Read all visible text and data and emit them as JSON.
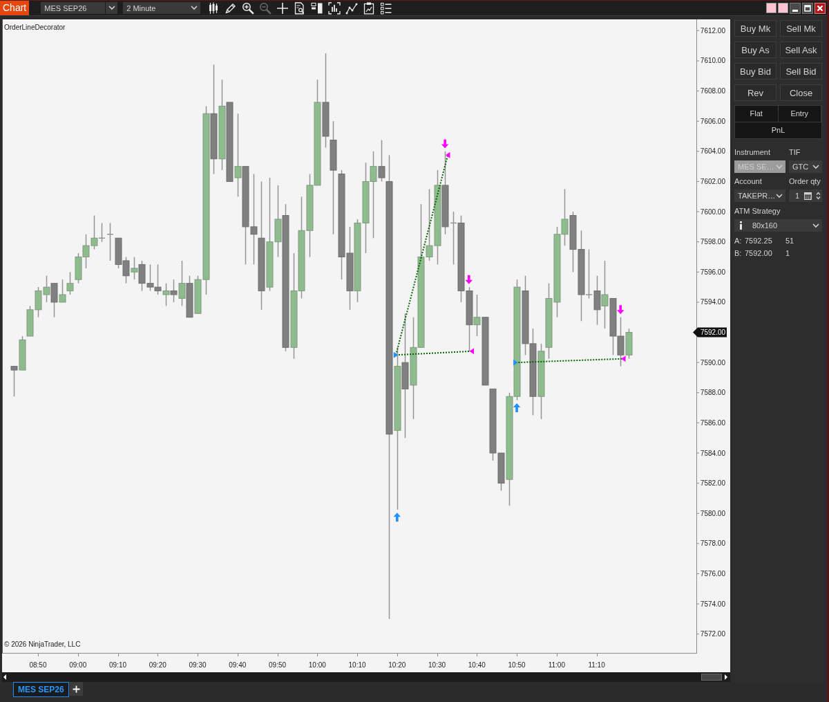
{
  "header": {
    "title": "Chart",
    "instrument": "MES SEP26",
    "interval": "2 Minute",
    "tools": [
      {
        "kind": "candles",
        "disabled": false
      },
      {
        "kind": "pencil",
        "disabled": false
      },
      {
        "kind": "zoom-in",
        "disabled": false
      },
      {
        "kind": "zoom-out",
        "disabled": true
      },
      {
        "kind": "crosshair",
        "disabled": false
      },
      {
        "kind": "data-box",
        "disabled": false
      },
      {
        "kind": "panel",
        "disabled": false
      },
      {
        "kind": "frame-chart",
        "disabled": false
      },
      {
        "kind": "line-chart",
        "disabled": false
      },
      {
        "kind": "clipboard",
        "disabled": false
      },
      {
        "kind": "list",
        "disabled": false
      }
    ]
  },
  "chart": {
    "indicator": "OrderLineDecorator",
    "copyright": "© 2026 NinjaTrader, LLC",
    "last_price": "7592.00",
    "chart_data": {
      "type": "candlestick",
      "x": [
        524,
        526,
        528,
        530,
        532,
        534,
        536,
        538,
        540,
        542,
        544,
        546,
        548,
        550,
        552,
        554,
        556,
        558,
        560,
        562,
        564,
        566,
        568,
        570,
        572,
        574,
        576,
        578,
        580,
        582,
        584,
        586,
        588,
        590,
        592,
        594,
        596,
        598,
        600,
        602,
        604,
        606,
        608,
        610,
        612,
        614,
        616,
        618,
        620,
        622,
        624,
        626,
        628,
        630,
        632,
        634,
        636,
        638,
        640,
        642,
        644,
        646,
        648,
        650,
        652,
        654,
        656,
        658,
        660,
        662,
        664,
        666,
        668,
        670,
        672,
        674,
        676,
        678
      ],
      "ohlc": [
        [
          7589.75,
          7589.75,
          7587.75,
          7589.5
        ],
        [
          7589.5,
          7591.75,
          7589.5,
          7591.5
        ],
        [
          7591.75,
          7593.75,
          7591.75,
          7593.5
        ],
        [
          7593.5,
          7595.0,
          7593.0,
          7594.75
        ],
        [
          7594.5,
          7595.75,
          7594.0,
          7595.0
        ],
        [
          7595.25,
          7595.25,
          7593.0,
          7594.0
        ],
        [
          7594.0,
          7595.5,
          7594.0,
          7594.5
        ],
        [
          7594.75,
          7596.0,
          7594.5,
          7595.25
        ],
        [
          7595.5,
          7597.25,
          7595.25,
          7597.0
        ],
        [
          7597.0,
          7598.5,
          7596.25,
          7597.75
        ],
        [
          7597.75,
          7599.75,
          7597.5,
          7598.25
        ],
        [
          7598.25,
          7599.25,
          7598.0,
          7598.25
        ],
        [
          7598.5,
          7599.25,
          7596.75,
          7598.5
        ],
        [
          7598.25,
          7598.25,
          7596.25,
          7596.5
        ],
        [
          7596.75,
          7597.0,
          7595.25,
          7595.75
        ],
        [
          7596.0,
          7597.0,
          7595.5,
          7596.25
        ],
        [
          7596.5,
          7596.75,
          7594.75,
          7595.25
        ],
        [
          7595.25,
          7596.5,
          7594.75,
          7595.0
        ],
        [
          7595.0,
          7596.5,
          7594.5,
          7594.75
        ],
        [
          7594.5,
          7595.25,
          7593.75,
          7594.75
        ],
        [
          7594.75,
          7595.5,
          7594.0,
          7594.5
        ],
        [
          7594.25,
          7596.75,
          7593.75,
          7595.25
        ],
        [
          7595.25,
          7595.75,
          7593.0,
          7593.0
        ],
        [
          7593.25,
          7595.75,
          7593.25,
          7595.5
        ],
        [
          7595.5,
          7607.0,
          7594.5,
          7606.5
        ],
        [
          7606.5,
          7609.75,
          7602.5,
          7603.5
        ],
        [
          7603.5,
          7608.75,
          7602.75,
          7607.0
        ],
        [
          7607.25,
          7607.25,
          7602.0,
          7602.0
        ],
        [
          7602.25,
          7606.5,
          7601.0,
          7603.0
        ],
        [
          7603.0,
          7603.0,
          7596.5,
          7599.0
        ],
        [
          7599.0,
          7602.5,
          7596.5,
          7598.5
        ],
        [
          7598.25,
          7602.0,
          7593.5,
          7594.75
        ],
        [
          7595.0,
          7602.25,
          7594.75,
          7598.0
        ],
        [
          7598.0,
          7601.75,
          7597.0,
          7599.5
        ],
        [
          7599.75,
          7600.5,
          7590.75,
          7591.0
        ],
        [
          7591.0,
          7597.25,
          7590.25,
          7594.75
        ],
        [
          7594.75,
          7601.0,
          7594.25,
          7598.75
        ],
        [
          7598.75,
          7602.5,
          7597.0,
          7601.75
        ],
        [
          7601.75,
          7608.75,
          7601.75,
          7607.25
        ],
        [
          7607.25,
          7610.5,
          7604.25,
          7605.0
        ],
        [
          7604.75,
          7606.0,
          7598.5,
          7602.75
        ],
        [
          7602.5,
          7602.75,
          7595.5,
          7597.0
        ],
        [
          7597.25,
          7599.0,
          7593.5,
          7594.75
        ],
        [
          7594.75,
          7599.5,
          7594.0,
          7599.25
        ],
        [
          7599.25,
          7603.25,
          7597.25,
          7602.0
        ],
        [
          7602.0,
          7604.0,
          7598.25,
          7603.0
        ],
        [
          7603.0,
          7604.75,
          7602.0,
          7602.25
        ],
        [
          7602.0,
          7603.75,
          7573.0,
          7585.25
        ],
        [
          7585.5,
          7591.0,
          7580.25,
          7589.75
        ],
        [
          7590.0,
          7593.25,
          7585.0,
          7588.25
        ],
        [
          7588.5,
          7593.0,
          7586.25,
          7591.0
        ],
        [
          7591.0,
          7600.5,
          7591.0,
          7597.0
        ],
        [
          7597.0,
          7601.5,
          7596.75,
          7597.75
        ],
        [
          7597.75,
          7602.75,
          7596.5,
          7601.75
        ],
        [
          7601.75,
          7604.0,
          7598.5,
          7599.0
        ],
        [
          7599.25,
          7600.0,
          7596.5,
          7599.25
        ],
        [
          7599.25,
          7599.75,
          7594.0,
          7594.75
        ],
        [
          7594.75,
          7595.0,
          7590.75,
          7592.5
        ],
        [
          7592.5,
          7594.5,
          7591.75,
          7593.0
        ],
        [
          7593.0,
          7593.0,
          7588.5,
          7588.5
        ],
        [
          7588.25,
          7588.25,
          7583.5,
          7584.0
        ],
        [
          7584.0,
          7584.0,
          7581.5,
          7582.0
        ],
        [
          7582.25,
          7588.0,
          7580.5,
          7587.75
        ],
        [
          7587.75,
          7595.5,
          7587.5,
          7595.0
        ],
        [
          7594.75,
          7595.75,
          7590.5,
          7591.25
        ],
        [
          7591.25,
          7592.25,
          7586.5,
          7587.75
        ],
        [
          7587.75,
          7591.25,
          7586.25,
          7590.75
        ],
        [
          7591.0,
          7595.25,
          7590.25,
          7594.25
        ],
        [
          7594.0,
          7599.0,
          7593.0,
          7598.5
        ],
        [
          7598.5,
          7601.5,
          7597.75,
          7599.5
        ],
        [
          7599.75,
          7600.0,
          7596.0,
          7597.5
        ],
        [
          7597.5,
          7598.75,
          7592.75,
          7594.5
        ],
        [
          7594.5,
          7597.5,
          7594.25,
          7594.5
        ],
        [
          7594.75,
          7595.75,
          7592.5,
          7593.5
        ],
        [
          7593.75,
          7596.75,
          7592.25,
          7594.5
        ],
        [
          7594.25,
          7594.25,
          7590.5,
          7591.75
        ],
        [
          7591.75,
          7593.0,
          7589.75,
          7590.5
        ],
        [
          7590.5,
          7592.25,
          7590.25,
          7592.0
        ]
      ],
      "xlim": [
        521,
        695
      ],
      "ylim": [
        7570.75,
        7612.75
      ],
      "xticks": [
        {
          "value": 530,
          "label": "08:50"
        },
        {
          "value": 540,
          "label": "09:00"
        },
        {
          "value": 550,
          "label": "09:10"
        },
        {
          "value": 560,
          "label": "09:20"
        },
        {
          "value": 570,
          "label": "09:30"
        },
        {
          "value": 580,
          "label": "09:40"
        },
        {
          "value": 590,
          "label": "09:50"
        },
        {
          "value": 600,
          "label": "10:00"
        },
        {
          "value": 610,
          "label": "10:10"
        },
        {
          "value": 620,
          "label": "10:20"
        },
        {
          "value": 630,
          "label": "10:30"
        },
        {
          "value": 640,
          "label": "10:40"
        },
        {
          "value": 650,
          "label": "10:50"
        },
        {
          "value": 660,
          "label": "11:00"
        },
        {
          "value": 670,
          "label": "11:10"
        }
      ],
      "yticks": [
        {
          "value": 7572,
          "label": "7572.00"
        },
        {
          "value": 7574,
          "label": "7574.00"
        },
        {
          "value": 7576,
          "label": "7576.00"
        },
        {
          "value": 7578,
          "label": "7578.00"
        },
        {
          "value": 7580,
          "label": "7580.00"
        },
        {
          "value": 7582,
          "label": "7582.00"
        },
        {
          "value": 7584,
          "label": "7584.00"
        },
        {
          "value": 7586,
          "label": "7586.00"
        },
        {
          "value": 7588,
          "label": "7588.00"
        },
        {
          "value": 7590,
          "label": "7590.00"
        },
        {
          "value": 7594,
          "label": "7594.00"
        },
        {
          "value": 7596,
          "label": "7596.00"
        },
        {
          "value": 7598,
          "label": "7598.00"
        },
        {
          "value": 7600,
          "label": "7600.00"
        },
        {
          "value": 7602,
          "label": "7602.00"
        },
        {
          "value": 7604,
          "label": "7604.00"
        },
        {
          "value": 7606,
          "label": "7606.00"
        },
        {
          "value": 7608,
          "label": "7608.00"
        },
        {
          "value": 7610,
          "label": "7610.00"
        },
        {
          "value": 7612,
          "label": "7612.00"
        }
      ]
    },
    "trades": {
      "chart_data": {
        "type": "line",
        "x": [
          619.7,
          632.7,
          619.7,
          638.7,
          649.7,
          676.7
        ],
        "series": [
          {
            "line_style": "dotted",
            "values": [
              7590.5,
              7603.75,
              null,
              null,
              null,
              null
            ]
          },
          {
            "line_style": "dotted",
            "values": [
              null,
              null,
              7590.5,
              7590.75,
              null,
              null
            ]
          },
          {
            "line_style": "dotted",
            "values": [
              null,
              null,
              null,
              null,
              7590.0,
              7590.25
            ]
          }
        ],
        "xlim": [
          521,
          695
        ],
        "ylim": [
          7570.75,
          7612.75
        ]
      }
    },
    "executions": {
      "chart_data": {
        "type": "scatter",
        "x": [
          619.7,
          620,
          632,
          632.7,
          638,
          638.7,
          649.7,
          650,
          676,
          676.7
        ],
        "series": [
          {
            "color": "#1e90ff",
            "values": [
              7590.5,
              null,
              null,
              null,
              null,
              null,
              7590.0,
              null,
              null,
              null
            ]
          },
          {
            "color": "#ff00ff",
            "values": [
              null,
              null,
              null,
              7603.75,
              null,
              7590.75,
              null,
              null,
              null,
              7590.25
            ]
          },
          {
            "color": "#1e90ff",
            "values": [
              null,
              7579.75,
              null,
              null,
              null,
              null,
              null,
              7587.0,
              null,
              null
            ]
          },
          {
            "color": "#ff00ff",
            "values": [
              null,
              null,
              7604.5,
              null,
              7595.5,
              null,
              null,
              null,
              7593.5,
              null
            ]
          }
        ],
        "xlim": [
          521,
          695
        ],
        "ylim": [
          7570.75,
          7612.75
        ]
      }
    }
  },
  "order_entry": {
    "buttons": [
      "Buy Mk",
      "Sell Mk",
      "Buy As",
      "Sell Ask",
      "Buy Bid",
      "Sell Bid",
      "Rev",
      "Close"
    ],
    "position": {
      "columns": [
        "Flat",
        "Entry"
      ],
      "pnl": "PnL"
    },
    "fields": [
      {
        "label": "Instrument",
        "value": "MES SE…",
        "kind": "dropdown",
        "disabled": true
      },
      {
        "label": "TIF",
        "value": "GTC",
        "kind": "dropdown",
        "disabled": false
      },
      {
        "label": "Account",
        "value": "TAKEPR…",
        "kind": "dropdown",
        "disabled": false
      },
      {
        "label": "Order qty",
        "value": "1",
        "kind": "spinner",
        "disabled": false
      }
    ],
    "atm_strategy": {
      "label": "ATM Strategy",
      "value": "80x160"
    },
    "quotes": [
      {
        "label": "A:",
        "price": "7592.25",
        "size": "51"
      },
      {
        "label": "B:",
        "price": "7592.00",
        "size": "1"
      }
    ]
  },
  "tabs": [
    {
      "label": "MES SEP26",
      "selected": true
    }
  ]
}
